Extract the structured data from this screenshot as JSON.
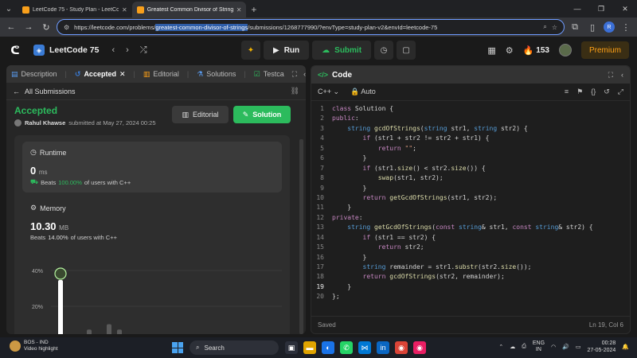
{
  "browser": {
    "tabs": [
      {
        "title": "LeetCode 75 - Study Plan - LeetCode",
        "active": false
      },
      {
        "title": "Greatest Common Divisor of Strings",
        "active": true
      }
    ],
    "url_prefix": "https://leetcode.com/problems/",
    "url_highlight": "greatest-common-divisor-of-strings",
    "url_suffix": "/submissions/1268777990/?envType=study-plan-v2&envId=leetcode-75",
    "profile_initial": "R"
  },
  "header": {
    "study_plan": "LeetCode 75",
    "run_label": "Run",
    "submit_label": "Submit",
    "streak": "153",
    "premium_label": "Premium"
  },
  "left": {
    "tabs": [
      {
        "label": "Description"
      },
      {
        "label": "Accepted"
      },
      {
        "label": "Editorial"
      },
      {
        "label": "Solutions"
      },
      {
        "label": "Testca"
      }
    ],
    "all_submissions": "All Submissions",
    "status": "Accepted",
    "user": "Rahul Khawse",
    "submitted_text": "submitted at May 27, 2024 00:25",
    "editorial_btn": "Editorial",
    "solution_btn": "Solution",
    "runtime": {
      "title": "Runtime",
      "value": "0",
      "unit": "ms",
      "beats_prefix": "Beats",
      "beats_pct": "100.00%",
      "beats_suffix": "of users with C++"
    },
    "memory": {
      "title": "Memory",
      "value": "10.30",
      "unit": "MB",
      "beats_prefix": "Beats",
      "beats_pct": "14.00%",
      "beats_suffix": "of users with C++"
    }
  },
  "chart_data": {
    "type": "bar",
    "yticks": [
      "40%",
      "20%"
    ],
    "ylim": [
      0,
      40
    ],
    "values": [
      40,
      7,
      10,
      7
    ]
  },
  "code_panel": {
    "title": "Code",
    "language": "C++",
    "mode": "Auto",
    "saved": "Saved",
    "cursor": "Ln 19, Col 6"
  },
  "code_lines": [
    "class Solution {",
    "public:",
    "    string gcdOfStrings(string str1, string str2) {",
    "        if (str1 + str2 != str2 + str1) {",
    "            return \"\";",
    "        }",
    "        if (str1.size() < str2.size()) {",
    "            swap(str1, str2);",
    "        }",
    "        return getGcdOfStrings(str1, str2);",
    "    }",
    "private:",
    "    string getGcdOfStrings(const string& str1, const string& str2) {",
    "        if (str1 == str2) {",
    "            return str2;",
    "        }",
    "        string remainder = str1.substr(str2.size());",
    "        return gcdOfStrings(str2, remainder);",
    "    }",
    "};"
  ],
  "taskbar": {
    "weather_line1": "BOS - IND",
    "weather_line2": "Video highlight",
    "search": "Search",
    "lang1": "ENG",
    "lang2": "IN",
    "time": "00:28",
    "date": "27-05-2024"
  }
}
